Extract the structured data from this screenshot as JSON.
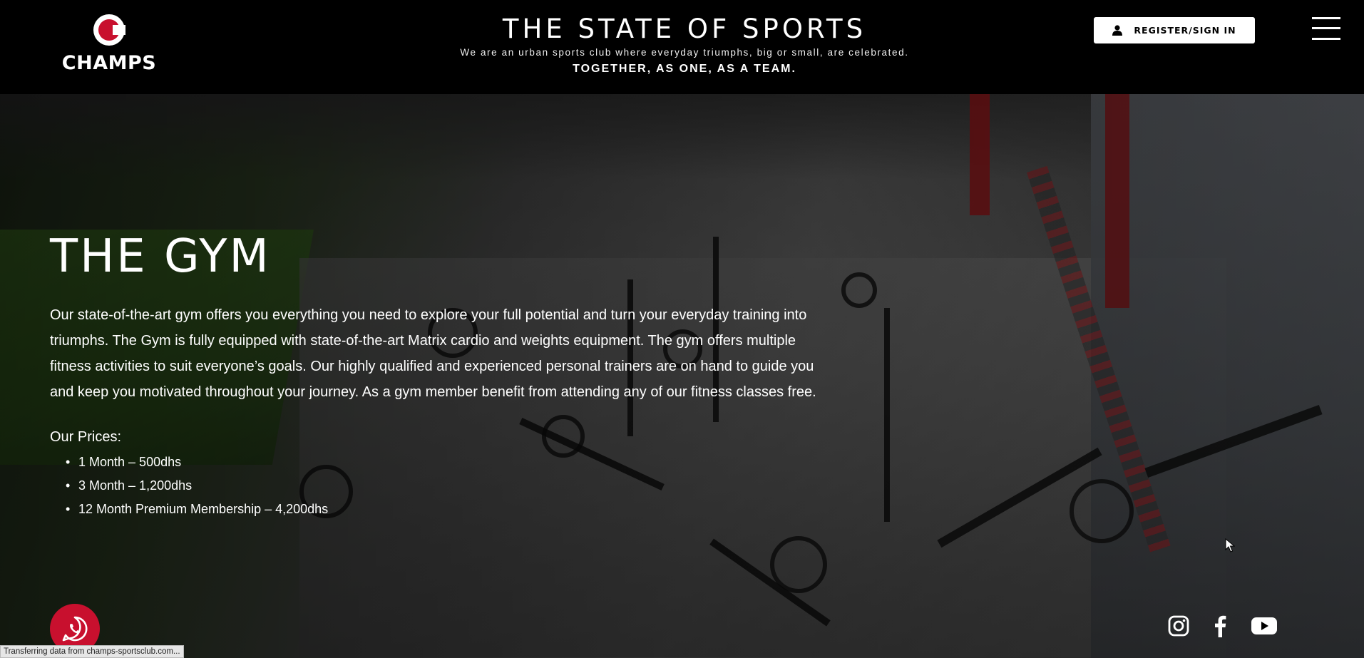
{
  "header": {
    "logo_text": "CHAMPS",
    "site_title": "THE STATE OF SPORTS",
    "site_subtitle": "We are an urban sports club where everyday triumphs, big or small, are celebrated.",
    "site_motto": "TOGETHER, AS ONE, AS A TEAM.",
    "register_label": "REGISTER/SIGN IN",
    "register_icon": "user-icon",
    "menu_icon": "hamburger-menu-icon"
  },
  "hero": {
    "title": "THE GYM",
    "intro": "Our state-of-the-art gym offers you everything you need to explore your full potential and turn your everyday training into triumphs. The Gym is fully equipped with state-of-the-art Matrix cardio and weights equipment. The gym offers multiple fitness activities to suit everyone’s goals. Our highly qualified and experienced personal trainers are on hand to guide you and keep you motivated throughout your journey. As a gym member benefit from attending any of our fitness classes free.",
    "prices_label": "Our Prices:",
    "prices": [
      "1 Month – 500dhs",
      "3 Month – 1,200dhs",
      "12 Month Premium Membership – 4,200dhs"
    ]
  },
  "floating": {
    "whatsapp_icon": "whatsapp-icon",
    "social_icons": [
      "instagram-icon",
      "facebook-icon",
      "youtube-icon"
    ]
  },
  "status_bar": {
    "text": "Transferring data from champs-sportsclub.com..."
  },
  "colors": {
    "brand_red": "#c8102e",
    "header_bg": "#000000",
    "text": "#ffffff"
  }
}
